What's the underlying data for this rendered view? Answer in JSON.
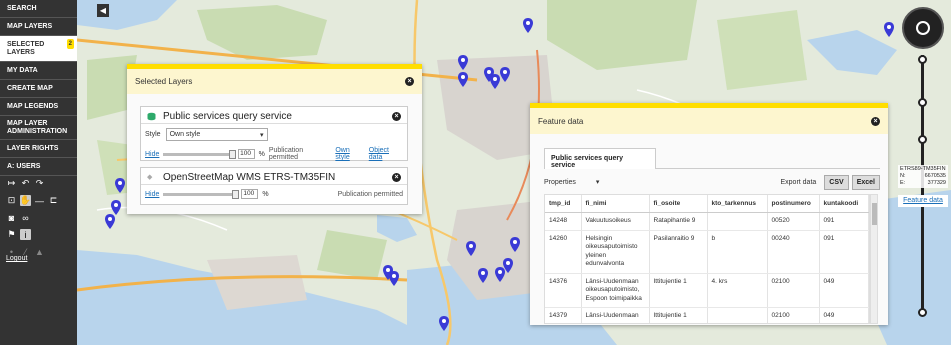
{
  "sidebar": {
    "items": [
      {
        "label": "SEARCH"
      },
      {
        "label": "MAP LAYERS"
      },
      {
        "label": "SELECTED LAYERS",
        "badge": "2"
      },
      {
        "label": "MY DATA"
      },
      {
        "label": "CREATE MAP"
      },
      {
        "label": "MAP LEGENDS"
      },
      {
        "label": "MAP LAYER ADMINISTRATION"
      },
      {
        "label": "LAYER RIGHTS"
      },
      {
        "label": "A: USERS"
      }
    ],
    "logout": "Logout"
  },
  "layers_panel": {
    "title": "Selected Layers",
    "layer1": {
      "name": "Public services query service",
      "style_label": "Style",
      "style_value": "Own style",
      "hide": "Hide",
      "opacity": "100",
      "pct": "%",
      "publication": "Publication permitted",
      "own_style": "Own style",
      "object_data": "Object data"
    },
    "layer2": {
      "name": "OpenStreetMap WMS ETRS-TM35FIN",
      "hide": "Hide",
      "opacity": "100",
      "pct": "%",
      "publication": "Publication permitted"
    }
  },
  "feature_panel": {
    "title": "Feature data",
    "tab": "Public services query service",
    "properties": "Properties",
    "export": "Export data",
    "csv": "CSV",
    "excel": "Excel",
    "columns": [
      "tmp_id",
      "fi_nimi",
      "fi_osoite",
      "kto_tarkennus",
      "postinumero",
      "kuntakoodi"
    ],
    "rows": [
      [
        "14248",
        "Vakuutusoikeus",
        "Ratapihantie 9",
        "",
        "00520",
        "091"
      ],
      [
        "14260",
        "Helsingin oikeusaputoimisto yleinen edunvalvonta",
        "Pasilanraitio 9",
        "b",
        "00240",
        "091"
      ],
      [
        "14376",
        "Länsi-Uudenmaan oikeusaputoimisto, Espoon toimipaikka",
        "Ittitujentie 1",
        "4. krs",
        "02100",
        "049"
      ],
      [
        "14379",
        "Länsi-Uudenmaan",
        "Ittitujentie 1",
        "",
        "02100",
        "049"
      ]
    ]
  },
  "map_controls": {
    "crs": "ETRS89-TM35FIN",
    "n_label": "N:",
    "n_value": "6670535",
    "e_label": "E:",
    "e_value": "377329",
    "feature_data_link": "Feature data"
  },
  "colors": {
    "accent": "#ffde00",
    "sidebar": "#333333",
    "pin": "#3a3ad6",
    "link": "#1a6fb8"
  }
}
